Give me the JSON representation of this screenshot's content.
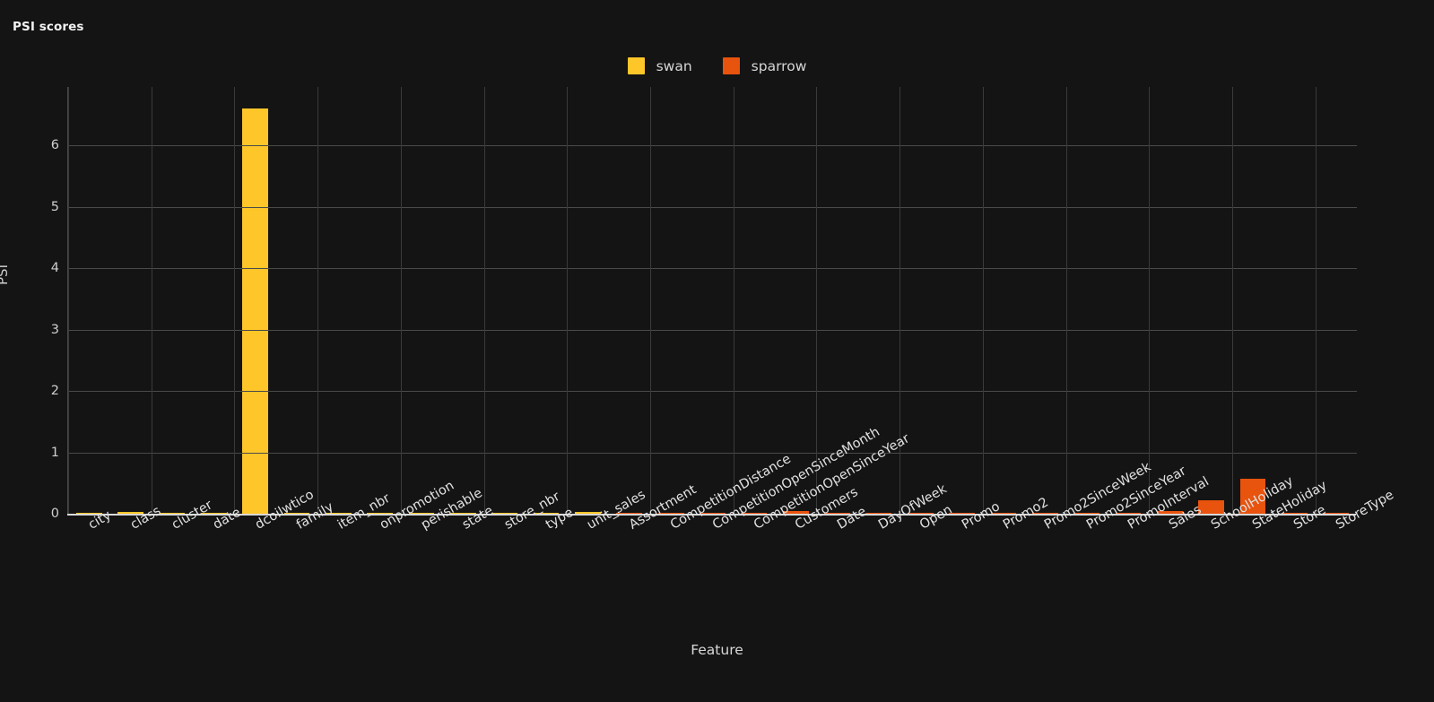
{
  "chart_data": {
    "type": "bar",
    "title": "PSI scores",
    "xlabel": "Feature",
    "ylabel": "PSI",
    "ylim": [
      0,
      6.95
    ],
    "yticks": [
      0,
      1,
      2,
      3,
      4,
      5,
      6
    ],
    "grid": true,
    "legend_position": "top-center",
    "colors": {
      "swan": "#FFC629",
      "sparrow": "#E8530E",
      "background": "#141414",
      "grid": "#4a4a4a",
      "text": "#e0e0e0"
    },
    "categories": [
      "city",
      "class",
      "cluster",
      "date",
      "dcoilwtico",
      "family",
      "item_nbr",
      "onpromotion",
      "perishable",
      "state",
      "store_nbr",
      "type",
      "unit_sales",
      "Assortment",
      "CompetitionDistance",
      "CompetitionOpenSinceMonth",
      "CompetitionOpenSinceYear",
      "Customers",
      "Date",
      "DayOfWeek",
      "Open",
      "Promo",
      "Promo2",
      "Promo2SinceWeek",
      "Promo2SinceYear",
      "PromoInterval",
      "Sales",
      "SchoolHoliday",
      "StateHoliday",
      "Store",
      "StoreType"
    ],
    "series": [
      {
        "name": "swan",
        "color": "#FFC629",
        "values": [
          0.01,
          0.03,
          0.01,
          0.01,
          6.6,
          0.02,
          0.02,
          0.02,
          0.01,
          0.01,
          0.02,
          0.02,
          0.03,
          0,
          0,
          0,
          0,
          0,
          0,
          0,
          0,
          0,
          0,
          0,
          0,
          0,
          0,
          0,
          0,
          0,
          0
        ]
      },
      {
        "name": "sparrow",
        "color": "#E8530E",
        "values": [
          0,
          0,
          0,
          0,
          0,
          0,
          0,
          0,
          0,
          0,
          0,
          0,
          0,
          0.02,
          0.02,
          0.02,
          0.02,
          0.04,
          0.01,
          0.01,
          0.01,
          0.01,
          0.02,
          0.02,
          0.02,
          0.01,
          0.04,
          0.22,
          0.57,
          0.01,
          0.01
        ]
      }
    ]
  },
  "legend": {
    "items": [
      {
        "label": "swan",
        "color": "#FFC629"
      },
      {
        "label": "sparrow",
        "color": "#E8530E"
      }
    ]
  }
}
